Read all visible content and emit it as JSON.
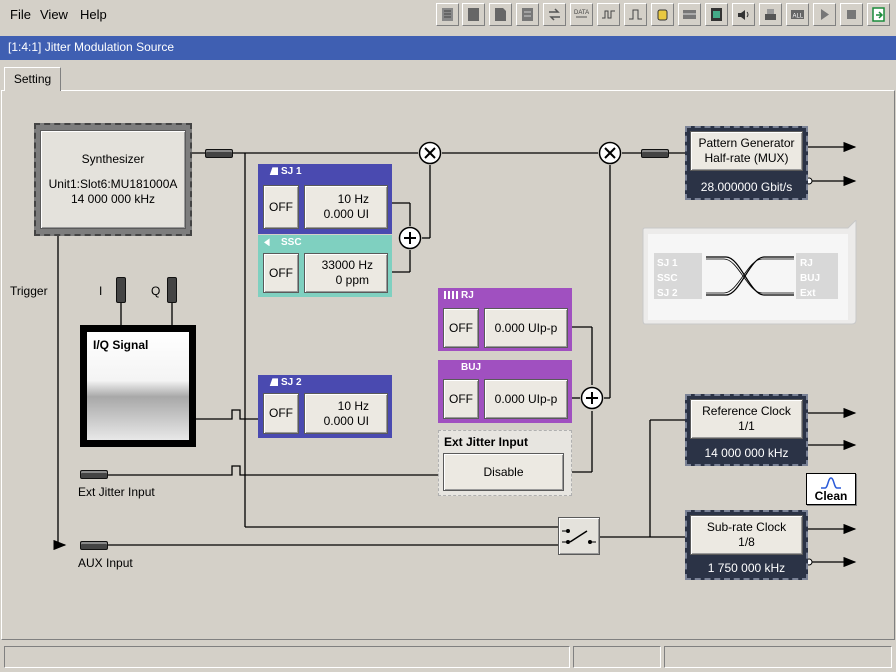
{
  "menu": {
    "file": "File",
    "view": "View",
    "help": "Help"
  },
  "toolbar": {
    "icons": [
      "list-icon",
      "panel-icon",
      "document-icon",
      "notes-icon",
      "shift-icon",
      "data-icon",
      "pattern-icon",
      "pulse-icon",
      "hand-icon",
      "table-icon",
      "film-icon",
      "speaker-icon",
      "printer-icon",
      "all-icon",
      "play-icon",
      "stop-icon",
      "exit-icon"
    ]
  },
  "window": {
    "title": "[1:4:1] Jitter Modulation Source"
  },
  "tabs": {
    "setting": "Setting"
  },
  "synth": {
    "title": "Synthesizer",
    "unit": "Unit1:Slot6:MU181000A",
    "freq": "14 000 000 kHz"
  },
  "trigger": "Trigger",
  "iq": {
    "i": "I",
    "q": "Q",
    "title": "I/Q Signal"
  },
  "sj1": {
    "header": "SJ 1",
    "off": "OFF",
    "freq": "10 Hz",
    "amp": "0.000 UI"
  },
  "ssc": {
    "header": "SSC",
    "off": "OFF",
    "freq": "33000 Hz",
    "amp": "0 ppm"
  },
  "sj2": {
    "header": "SJ 2",
    "off": "OFF",
    "freq": "10 Hz",
    "amp": "0.000 UI"
  },
  "rj": {
    "header": "RJ",
    "off": "OFF",
    "value": "0.000 UIp-p"
  },
  "bu": {
    "header": "BUJ",
    "off": "OFF",
    "value": "0.000 UIp-p"
  },
  "ext_jitter": {
    "title": "Ext Jitter Input",
    "button": "Disable"
  },
  "ext_jitter_input_label": "Ext Jitter Input",
  "aux_input_label": "AUX Input",
  "pg": {
    "line1": "Pattern Generator",
    "line2": "Half-rate (MUX)",
    "rate": "28.000000 Gbit/s"
  },
  "eye": {
    "sj1": "SJ 1",
    "ssc": "SSC",
    "sj2": "SJ 2",
    "rj": "RJ",
    "buj": "BUJ",
    "ext": "Ext"
  },
  "ref": {
    "title": "Reference Clock",
    "ratio": "1/1",
    "freq": "14 000 000 kHz"
  },
  "clean": {
    "label": "Clean"
  },
  "sub": {
    "title": "Sub-rate Clock",
    "ratio": "1/8",
    "freq": "1 750 000 kHz"
  },
  "colors": {
    "title_bar": "#3f5fb2",
    "sj": "#4a4ab0",
    "ssc": "#7fd0c0",
    "rj": "#a050c0",
    "dark_box": "#2b3346"
  }
}
